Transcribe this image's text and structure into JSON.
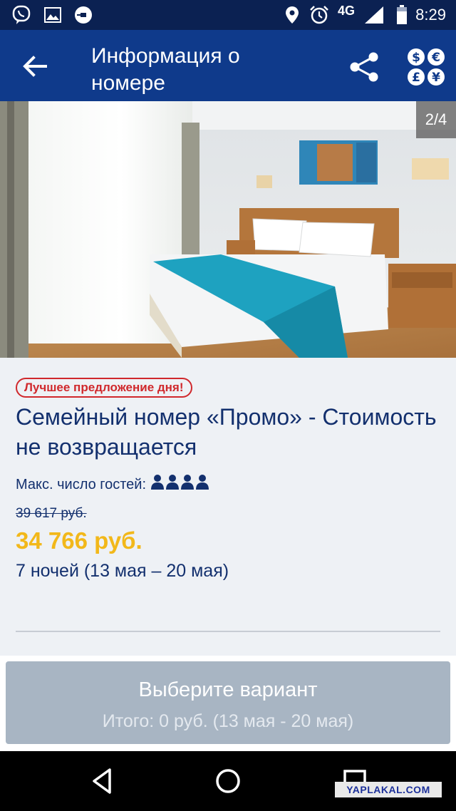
{
  "status_bar": {
    "time": "8:29",
    "network": "4G",
    "icons": [
      "viber-icon",
      "image-icon",
      "uber-icon",
      "location-icon",
      "alarm-icon",
      "signal-icon",
      "battery-icon"
    ]
  },
  "app_bar": {
    "title": "Информация о номере",
    "back_icon": "arrow-left-icon",
    "share_icon": "share-icon",
    "currency_icon": "currency-icon"
  },
  "gallery": {
    "counter": "2/4"
  },
  "room": {
    "badge": "Лучшее предложение дня!",
    "title": "Семейный номер «Промо» - Стоимость не возвращается",
    "guests_label": "Макс. число гостей:",
    "guests_count": 4,
    "old_price": "39 617 руб.",
    "price": "34 766 руб.",
    "nights": "7 ночей (13 мая – 20 мая)"
  },
  "select": {
    "label": "Выберите вариант",
    "total": "Итого: 0 руб. (13 мая - 20 мая)"
  },
  "navigation": {
    "back_icon": "nav-back-icon",
    "home_icon": "nav-home-icon",
    "recents_icon": "nav-recents-icon"
  },
  "watermark": "YAPLAKAL.COM",
  "colors": {
    "status_bar": "#0b2152",
    "app_bar": "#0f3a8b",
    "title_text": "#13306e",
    "badge_red": "#d0282c",
    "price_yellow": "#f2b81a",
    "button_disabled": "#a8b5c3"
  }
}
